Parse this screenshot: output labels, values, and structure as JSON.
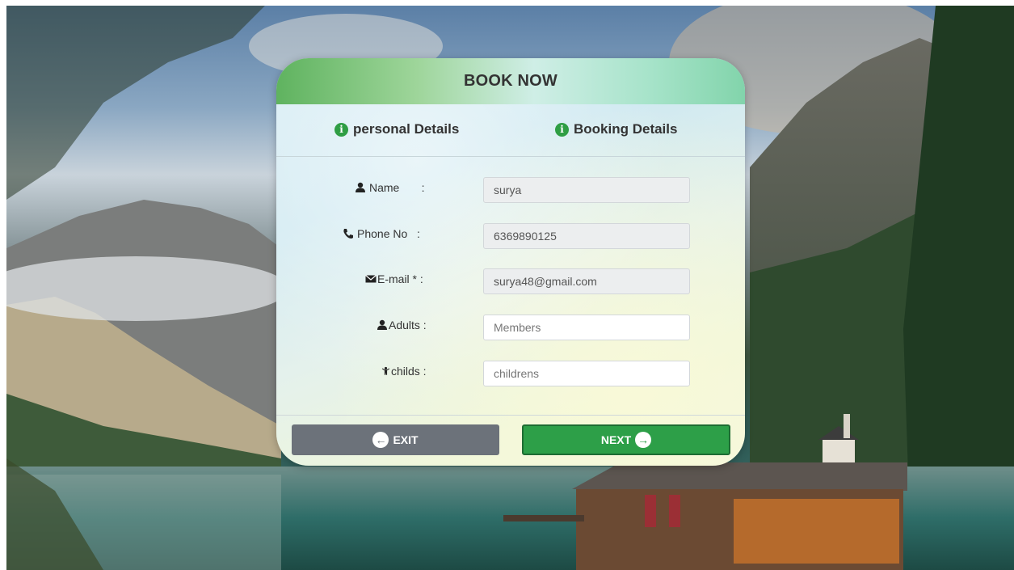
{
  "modal": {
    "title": "BOOK NOW"
  },
  "steps": [
    {
      "label": "personal Details",
      "icon": "info-circle-icon"
    },
    {
      "label": "Booking Details",
      "icon": "info-circle-icon"
    }
  ],
  "form": {
    "name": {
      "label": "Name       :",
      "value": "surya",
      "icon": "user-icon"
    },
    "phone": {
      "label": "Phone No   :",
      "value": "6369890125",
      "icon": "phone-icon"
    },
    "email": {
      "label": "E-mail * :",
      "value": "surya48@gmail.com",
      "icon": "envelope-icon"
    },
    "adults": {
      "label": "Adults :",
      "placeholder": "Members",
      "icon": "user-icon"
    },
    "childs": {
      "label": "childs :",
      "placeholder": "childrens",
      "icon": "child-icon"
    }
  },
  "buttons": {
    "exit": {
      "label": "EXIT",
      "icon": "arrow-left-circle-icon"
    },
    "next": {
      "label": "NEXT",
      "icon": "arrow-right-circle-icon"
    }
  },
  "colors": {
    "accent_green": "#2d9f48",
    "exit_gray": "#6c727a",
    "header_green": "#5fb35f"
  }
}
